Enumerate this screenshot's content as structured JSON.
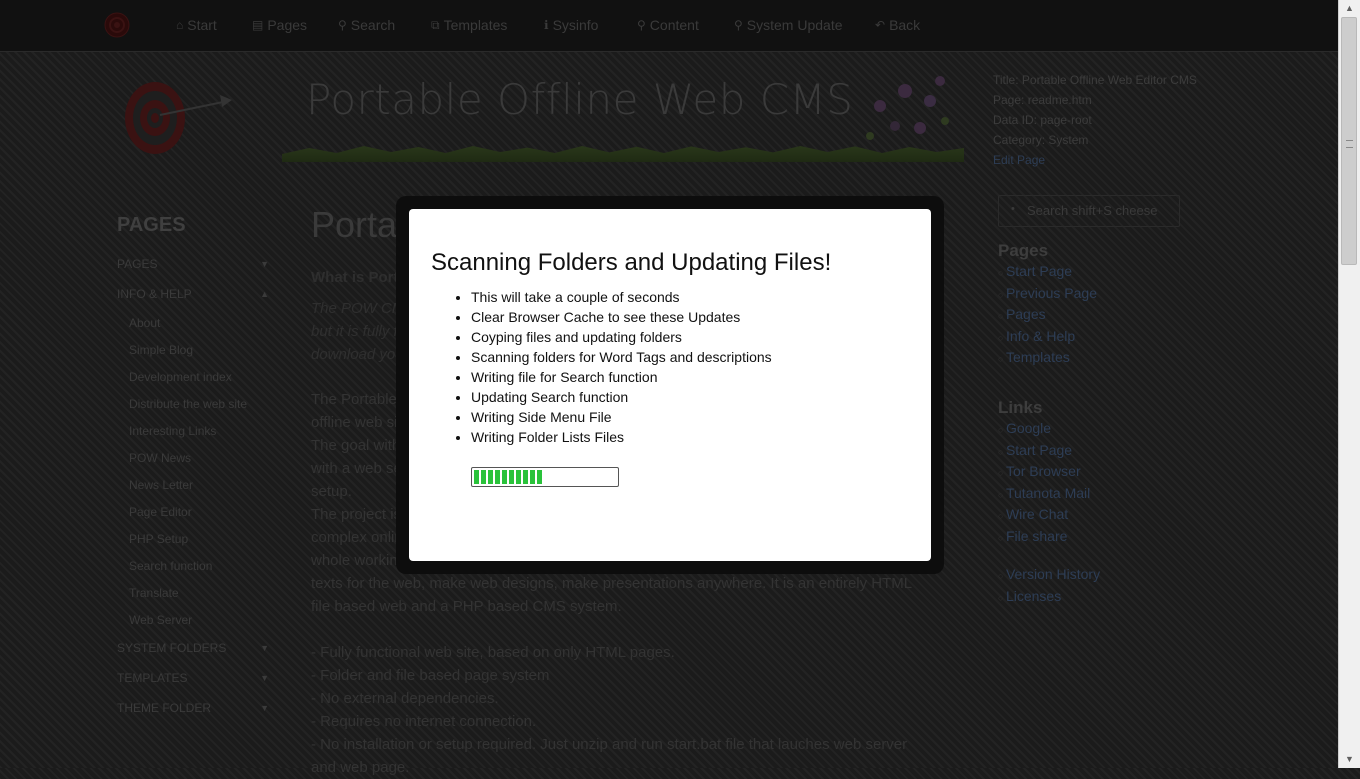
{
  "topnav": {
    "items": [
      {
        "label": "Start",
        "icon": "home-icon",
        "glyph": "⌂"
      },
      {
        "label": "Pages",
        "icon": "page-icon",
        "glyph": "▤"
      },
      {
        "label": "Search",
        "icon": "search-icon",
        "glyph": "⚲"
      },
      {
        "label": "Templates",
        "icon": "templates-icon",
        "glyph": "⧉"
      },
      {
        "label": "Sysinfo",
        "icon": "info-icon",
        "glyph": "ℹ"
      },
      {
        "label": "Content",
        "icon": "search-icon",
        "glyph": "⚲"
      },
      {
        "label": "System Update",
        "icon": "search-icon",
        "glyph": "⚲"
      },
      {
        "label": "Back",
        "icon": "back-icon",
        "glyph": "↶"
      }
    ]
  },
  "banner": {
    "title": "Portable Offline Web CMS"
  },
  "pageinfo": {
    "title": "Title: Portable Offline Web Editor CMS",
    "page": "Page: readme.htm",
    "data_id": "Data ID: page-root",
    "category": "Category: System",
    "edit": "Edit Page"
  },
  "sidebar": {
    "heading": "PAGES",
    "sections": [
      {
        "label": "PAGES",
        "arrow": "▼"
      },
      {
        "label": "INFO & HELP",
        "arrow": "▲"
      }
    ],
    "sub_items": [
      "About",
      "Simple Blog",
      "Development index",
      "Distribute the web site",
      "Interesting Links",
      "POW News",
      "News Letter",
      "Page Editor",
      "PHP Setup",
      "Search function",
      "Translate",
      "Web Server"
    ],
    "bottom_sections": [
      {
        "label": "SYSTEM FOLDERS",
        "arrow": "▼"
      },
      {
        "label": "TEMPLATES",
        "arrow": "▼"
      },
      {
        "label": "THEME FOLDER",
        "arrow": "▼"
      }
    ]
  },
  "content": {
    "title": "Porta",
    "subtitle": "What is Porta",
    "intro": [
      "The POW CM",
      "but it is fully fu",
      "download you"
    ],
    "p1": [
      "The Portable",
      "offline web sit",
      "The goal with",
      "with a web se",
      "setup."
    ],
    "p2": [
      "The project is",
      "complex onlin",
      "whole working",
      "texts for the web, make web designs, make presentations anywhere. It is an entirely HTML",
      "file based web and a PHP based CMS system."
    ],
    "features": [
      "- Fully functional web site, based on only HTML pages.",
      "- Folder and file based page system",
      "- No external dependencies.",
      "- Requires no internet connection.",
      "- No installation or setup required. Just unzip and run start.bat file that lauches web server",
      "and web page."
    ]
  },
  "right": {
    "search_placeholder": "Search shift+S cheese",
    "pages_heading": "Pages",
    "pages": [
      "Start Page",
      "Previous Page",
      "Pages",
      "Info & Help",
      "Templates"
    ],
    "links_heading": "Links",
    "links": [
      "Google",
      "Start Page",
      "Tor Browser",
      "Tutanota Mail",
      "Wire Chat",
      "File share"
    ],
    "more": [
      "Version History",
      "Licenses"
    ]
  },
  "modal": {
    "title": "Scanning Folders and Updating Files!",
    "items": [
      "This will take a couple of seconds",
      "Clear Browser Cache to see these Updates",
      "Coyping files and updating folders",
      "Scanning folders for Word Tags and descriptions",
      "Writing file for Search function",
      "Updating Search function",
      "Writing Side Menu File",
      "Writing Folder Lists Files"
    ],
    "progress": 0.49,
    "progress_color": "#29c23a"
  }
}
